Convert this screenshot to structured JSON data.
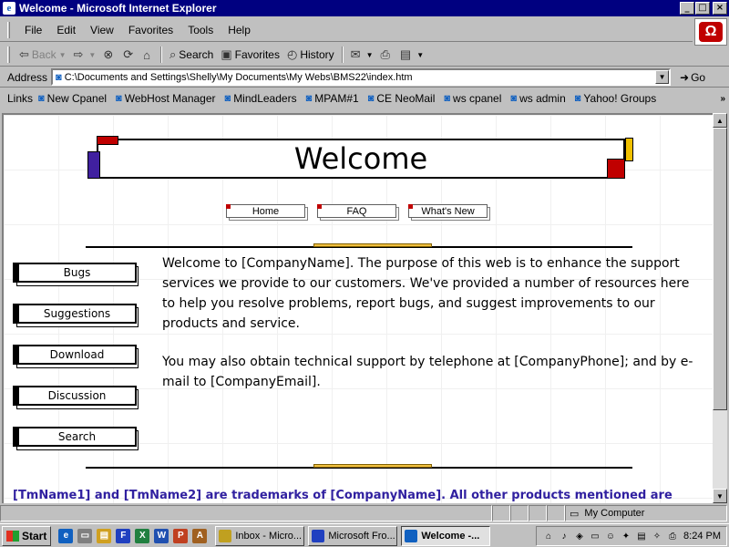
{
  "window": {
    "title": "Welcome - Microsoft Internet Explorer",
    "minimize": "_",
    "maximize": "□",
    "close": "×"
  },
  "menu": [
    "File",
    "Edit",
    "View",
    "Favorites",
    "Tools",
    "Help"
  ],
  "toolbar": {
    "back": "Back",
    "forward": "",
    "search": "Search",
    "favorites": "Favorites",
    "history": "History"
  },
  "address": {
    "label": "Address",
    "url": "C:\\Documents and Settings\\Shelly\\My Documents\\My Webs\\BMS22\\index.htm",
    "go": "Go"
  },
  "links": {
    "label": "Links",
    "items": [
      "New Cpanel",
      "WebHost Manager",
      "MindLeaders",
      "MPAM#1",
      "CE NeoMail",
      "ws cpanel",
      "ws admin",
      "Yahoo! Groups"
    ],
    "more": "»"
  },
  "page": {
    "banner": "Welcome",
    "topnav": [
      "Home",
      "FAQ",
      "What's New"
    ],
    "sidenav": [
      "Bugs",
      "Suggestions",
      "Download",
      "Discussion",
      "Search"
    ],
    "para1": "Welcome to [CompanyName]. The purpose of this web is to enhance the support services we provide to our customers. We've provided a number of resources here to help you resolve problems, report bugs, and suggest improvements to our products and service.",
    "para2": "You may also obtain technical support by telephone at [CompanyPhone]; and by e-mail to [CompanyEmail].",
    "trademark": "[TmName1] and [TmName2] are trademarks of [CompanyName]. All other products mentioned are"
  },
  "status": {
    "zone": "My Computer"
  },
  "taskbar": {
    "start": "Start",
    "tasks": [
      "Inbox - Micro...",
      "Microsoft Fro...",
      "Welcome -..."
    ],
    "clock": "8:24 PM"
  },
  "colors": {
    "titlebar": "#000080",
    "banner_red": "#c00000",
    "banner_purple": "#4020a0",
    "banner_yellow": "#f0c000",
    "trademark_text": "#3020a0"
  }
}
